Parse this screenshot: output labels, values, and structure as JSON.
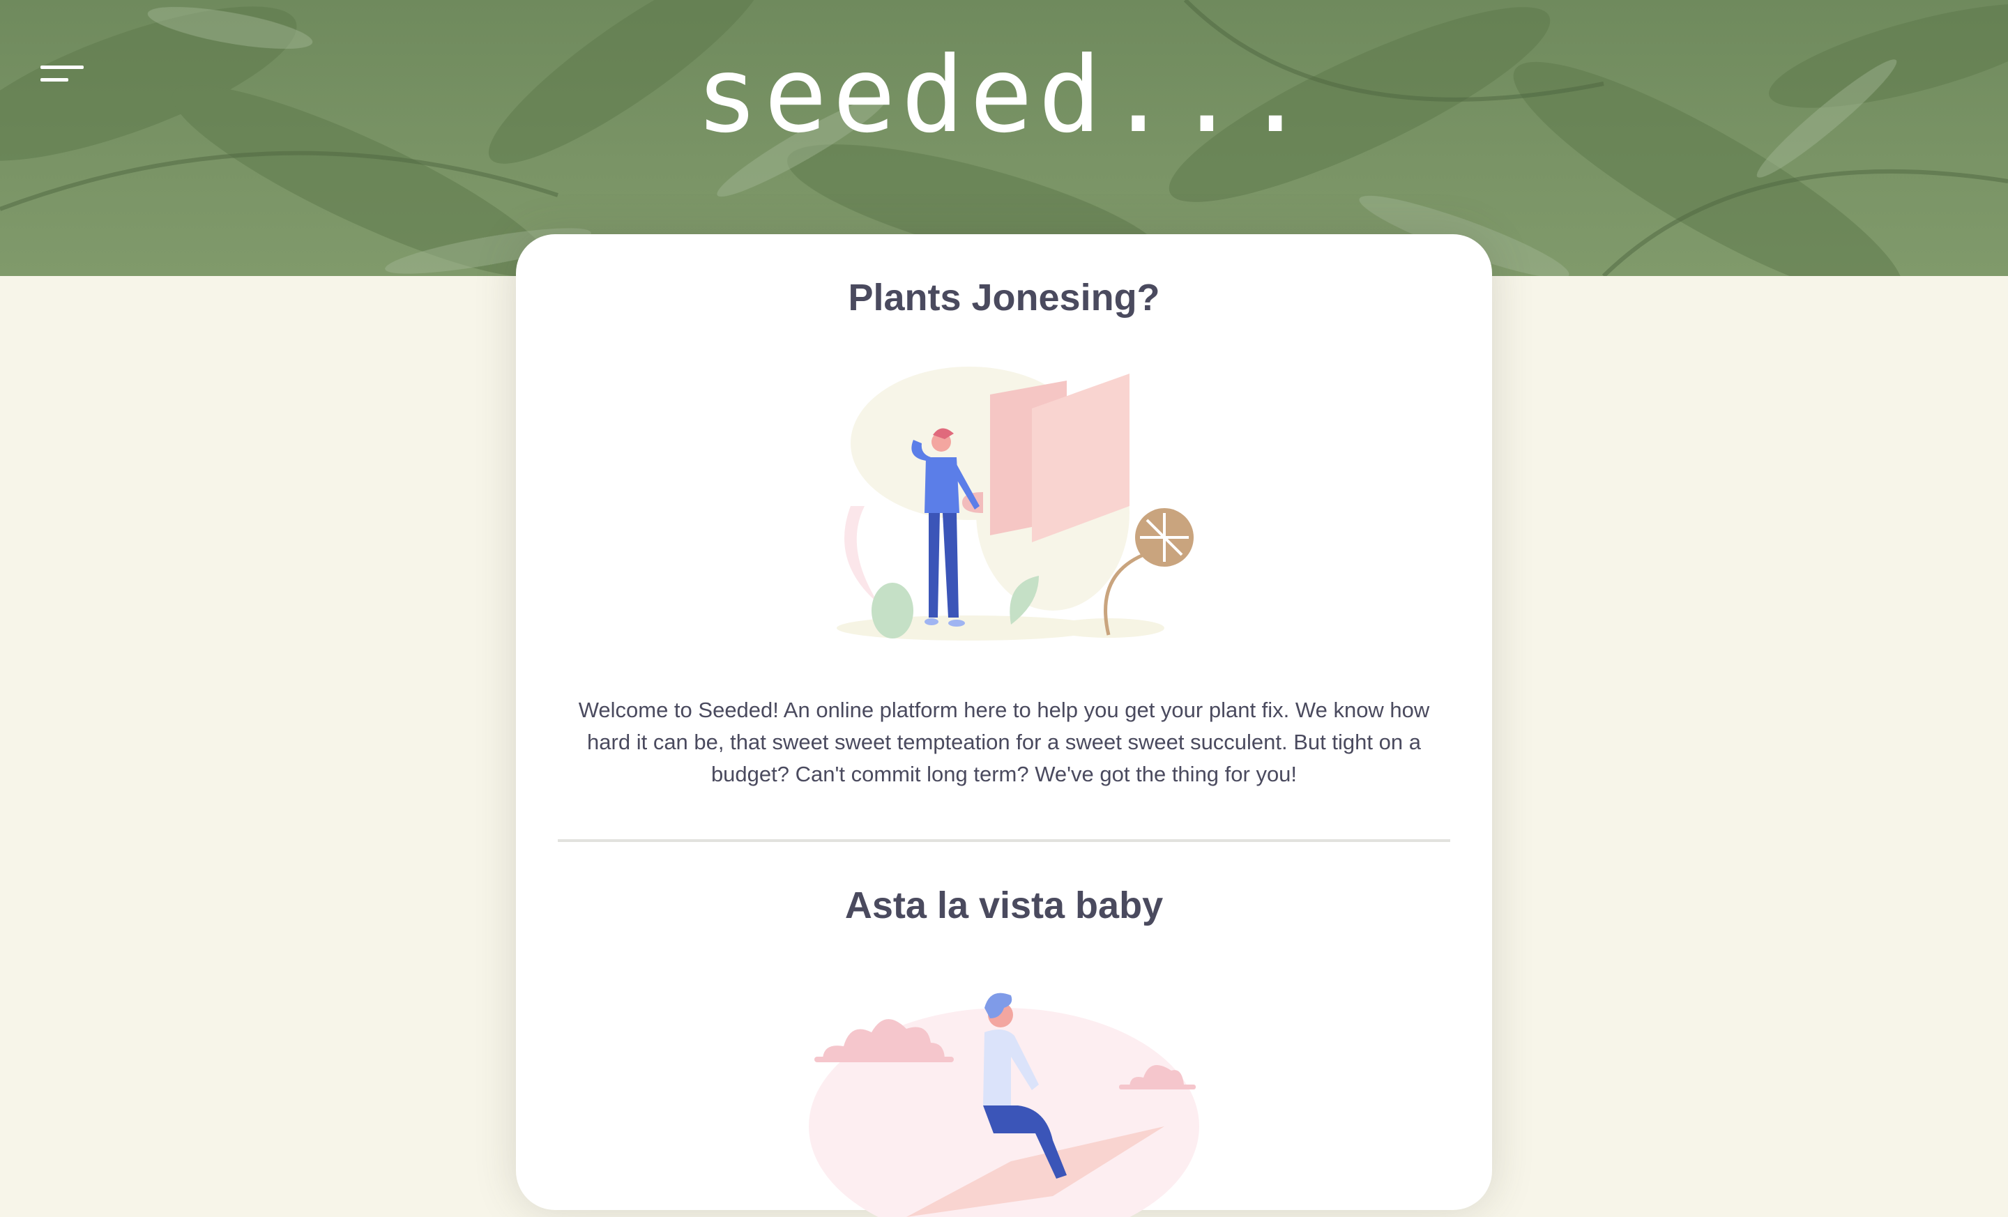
{
  "header": {
    "logo": "seeded...",
    "menu_icon": "hamburger-menu-icon"
  },
  "sections": [
    {
      "title": "Plants Jonesing?",
      "illustration": "person-looking-at-panels-illustration",
      "body": "Welcome to Seeded! An online platform here to help you get your plant fix. We know how hard it can be, that sweet sweet tempteation for a sweet sweet succulent. But tight on a budget? Can't commit long term? We've got the thing for you!"
    },
    {
      "title": "Asta la vista baby",
      "illustration": "person-riding-paper-plane-illustration"
    }
  ],
  "colors": {
    "background": "#f7f5e9",
    "hero_green": "#738e60",
    "card": "#ffffff",
    "text": "#4a4a5e",
    "accent_pink": "#f2c4c4",
    "accent_blue": "#5b7ee8"
  }
}
